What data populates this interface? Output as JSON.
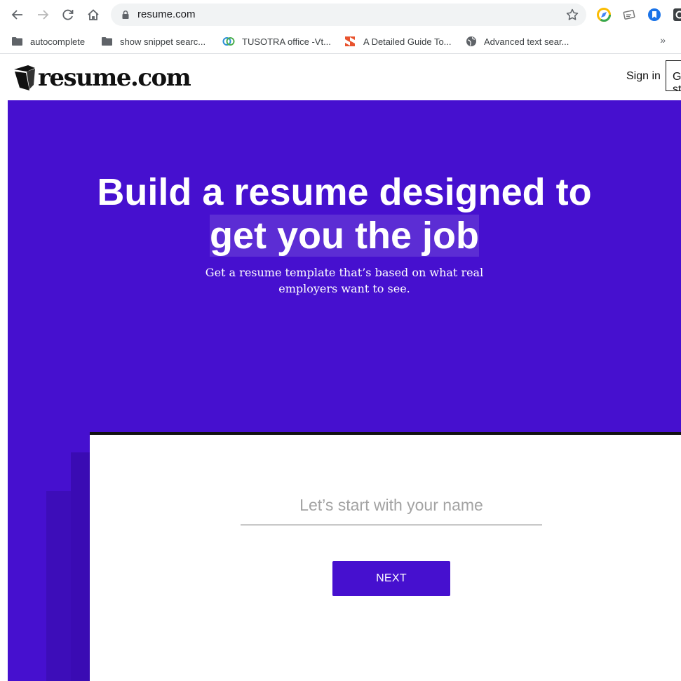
{
  "browser": {
    "url": "resume.com",
    "bookmarks": [
      {
        "label": "autocomplete",
        "icon": "folder-icon"
      },
      {
        "label": "show snippet searc...",
        "icon": "folder-icon"
      },
      {
        "label": "TUSOTRA office -Vt...",
        "icon": "tusotra-icon"
      },
      {
        "label": "A Detailed Guide To...",
        "icon": "scribd-icon"
      },
      {
        "label": "Advanced text sear...",
        "icon": "globe-icon"
      }
    ],
    "more_label": "»"
  },
  "site": {
    "logo_text": "resume.com",
    "signin_label": "Sign in",
    "get_started_label": "Get started"
  },
  "hero": {
    "title_line1": "Build a resume designed to",
    "title_line2": "get you the job",
    "subtitle_line1": "Get a resume template that’s based on what real",
    "subtitle_line2": "employers want to see."
  },
  "form": {
    "name_placeholder": "Let’s start with your name",
    "next_label": "NEXT"
  },
  "colors": {
    "brand": "#4610cf",
    "card_border": "#111111"
  }
}
